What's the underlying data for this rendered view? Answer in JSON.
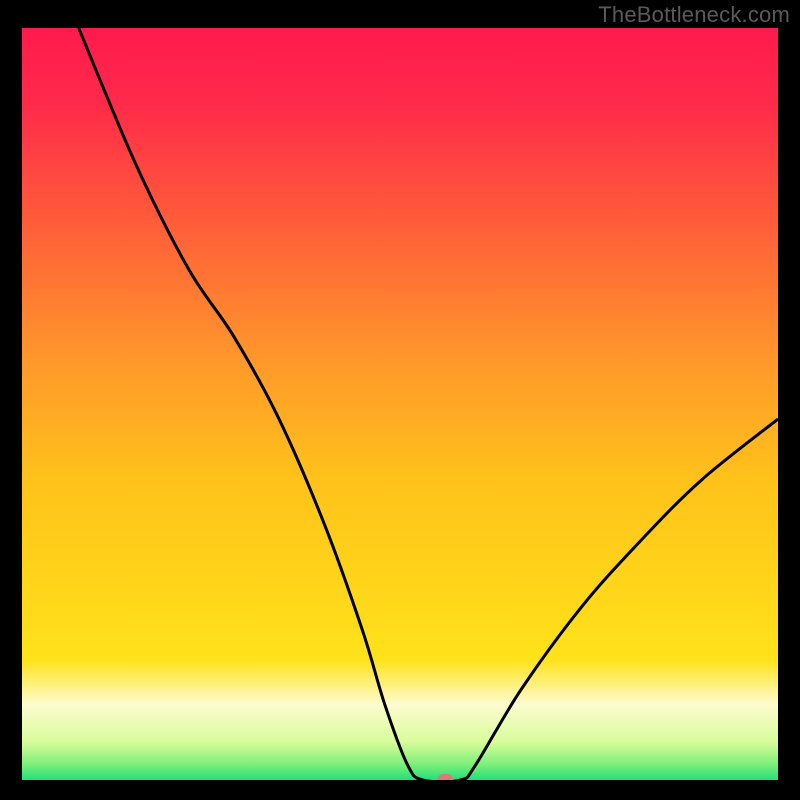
{
  "watermark": "TheBottleneck.com",
  "colors": {
    "background": "#000000",
    "curve": "#000000",
    "marker": "#da7a7a",
    "green": "#22e07a",
    "white": "#ffffff",
    "red_top": "#ff1a4d",
    "orange": "#ff9a2a",
    "yellow": "#ffe21a"
  },
  "chart_data": {
    "type": "line",
    "title": "",
    "xlabel": "",
    "ylabel": "",
    "xlim": [
      0,
      100
    ],
    "ylim": [
      0,
      100
    ],
    "legend": [],
    "annotations": [],
    "marker": {
      "x": 56,
      "y": 0
    },
    "series": [
      {
        "name": "bottleneck-curve",
        "points": [
          {
            "x": 7.5,
            "y": 100
          },
          {
            "x": 15,
            "y": 82
          },
          {
            "x": 22,
            "y": 68
          },
          {
            "x": 28,
            "y": 59
          },
          {
            "x": 34,
            "y": 48
          },
          {
            "x": 40,
            "y": 34
          },
          {
            "x": 45,
            "y": 20
          },
          {
            "x": 48,
            "y": 10
          },
          {
            "x": 51,
            "y": 2
          },
          {
            "x": 53,
            "y": 0
          },
          {
            "x": 58,
            "y": 0
          },
          {
            "x": 60,
            "y": 2
          },
          {
            "x": 66,
            "y": 12
          },
          {
            "x": 74,
            "y": 23
          },
          {
            "x": 82,
            "y": 32
          },
          {
            "x": 90,
            "y": 40
          },
          {
            "x": 100,
            "y": 48
          }
        ]
      }
    ],
    "gradient_bands": [
      {
        "pos": 0.0,
        "color": "#22e07a"
      },
      {
        "pos": 0.02,
        "color": "#7aef7a"
      },
      {
        "pos": 0.05,
        "color": "#d7fc9a"
      },
      {
        "pos": 0.1,
        "color": "#fdfccf"
      },
      {
        "pos": 0.16,
        "color": "#ffe21a"
      },
      {
        "pos": 0.4,
        "color": "#ffc21a"
      },
      {
        "pos": 0.55,
        "color": "#ff9a2a"
      },
      {
        "pos": 0.75,
        "color": "#ff5a3a"
      },
      {
        "pos": 0.9,
        "color": "#ff2a4a"
      },
      {
        "pos": 1.0,
        "color": "#ff1a4d"
      }
    ]
  }
}
